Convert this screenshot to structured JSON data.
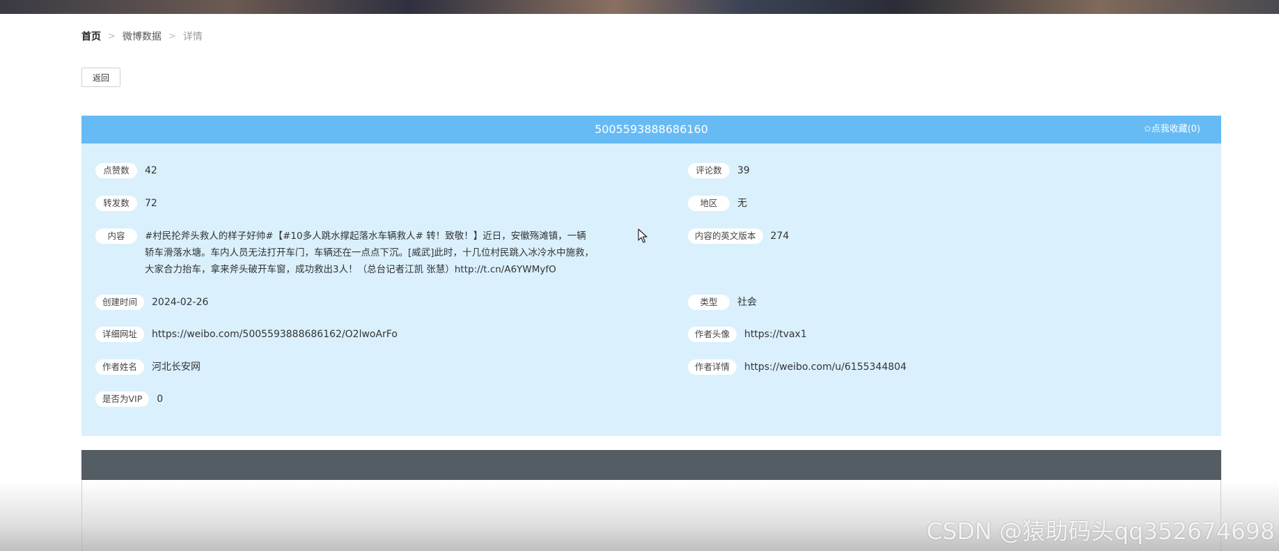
{
  "breadcrumb": {
    "home": "首页",
    "section": "微博数据",
    "current": "详情",
    "separator": ">"
  },
  "back_button": "返回",
  "detail": {
    "title": "5005593888686160",
    "favorite_label": "✩点我收藏(0)",
    "fields": {
      "likes": {
        "label": "点赞数",
        "value": "42"
      },
      "comments": {
        "label": "评论数",
        "value": "39"
      },
      "reposts": {
        "label": "转发数",
        "value": "72"
      },
      "region": {
        "label": "地区",
        "value": "无"
      },
      "content": {
        "label": "内容",
        "value": "#村民抡斧头救人的样子好帅#【#10多人跳水撑起落水车辆救人# 转！致敬！】近日，安徽殇滩镇，一辆轿车滑落水塘。车内人员无法打开车门，车辆还在一点点下沉。[威武]此时，十几位村民跳入冰冷水中施救，大家合力抬车，拿来斧头破开车窗，成功救出3人！（总台记者江凯 张慧）http://t.cn/A6YWMyfO"
      },
      "content_en": {
        "label": "内容的英文版本",
        "value": "274"
      },
      "created": {
        "label": "创建时间",
        "value": "2024-02-26"
      },
      "type": {
        "label": "类型",
        "value": "社会"
      },
      "url": {
        "label": "详细网址",
        "value": "https://weibo.com/5005593888686162/O2lwoArFo"
      },
      "avatar": {
        "label": "作者头像",
        "value": "https://tvax1"
      },
      "author_name": {
        "label": "作者姓名",
        "value": "河北长安网"
      },
      "author_detail": {
        "label": "作者详情",
        "value": "https://weibo.com/u/6155344804"
      },
      "vip": {
        "label": "是否为VIP",
        "value": "0"
      }
    }
  },
  "watermark": "CSDN @猿助码头qq352674698",
  "colors": {
    "header_blue": "#66bbf5",
    "panel_bg": "#daf0fd",
    "dark_bar": "#545c64"
  }
}
